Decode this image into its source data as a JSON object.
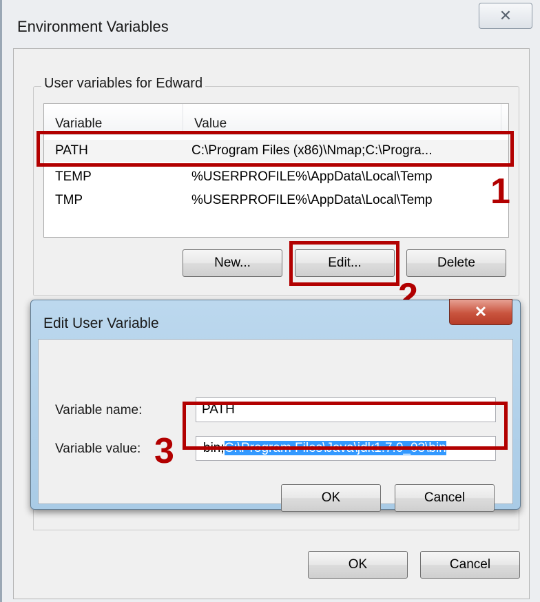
{
  "outer_dialog": {
    "title": "Environment Variables",
    "close_glyph": "✕",
    "user_group_label": "User variables for Edward",
    "columns": [
      "Variable",
      "Value"
    ],
    "rows": [
      {
        "variable": "PATH",
        "value": "C:\\Program Files (x86)\\Nmap;C:\\Progra..."
      },
      {
        "variable": "TEMP",
        "value": "%USERPROFILE%\\AppData\\Local\\Temp"
      },
      {
        "variable": "TMP",
        "value": "%USERPROFILE%\\AppData\\Local\\Temp"
      }
    ],
    "buttons": {
      "new": "New...",
      "edit": "Edit...",
      "delete": "Delete"
    },
    "ok": "OK",
    "cancel": "Cancel"
  },
  "inner_dialog": {
    "title": "Edit User Variable",
    "close_glyph": "✕",
    "name_label": "Variable name:",
    "name_value": "PATH",
    "value_label": "Variable value:",
    "value_prefix": "bin;",
    "value_selected": "C:\\Program Files\\Java\\jdk1.7.0_03\\bin",
    "ok": "OK",
    "cancel": "Cancel"
  },
  "annotations": {
    "step1": "1",
    "step2": "2",
    "step3": "3",
    "color": "#b20000"
  }
}
